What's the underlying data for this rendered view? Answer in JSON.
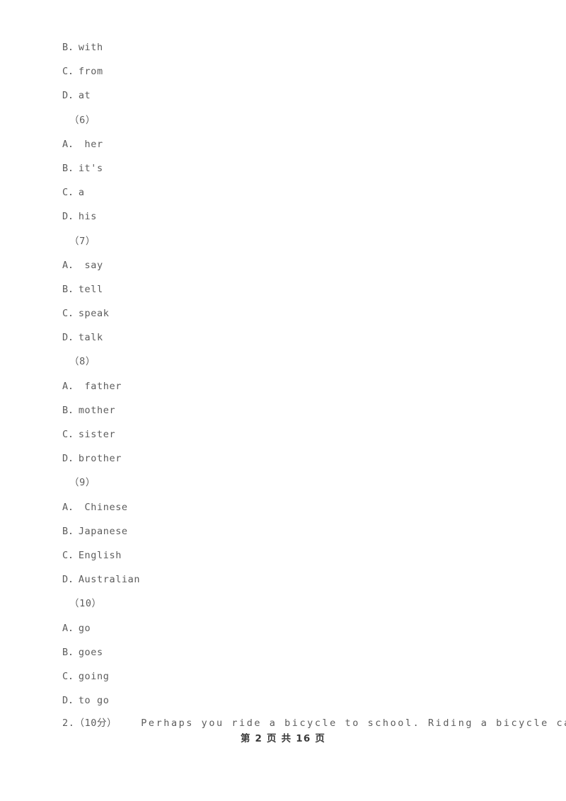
{
  "document": {
    "page_footer": "第 2 页 共 16 页",
    "lines": [
      {
        "kind": "option",
        "text": "B．with"
      },
      {
        "kind": "option",
        "text": "C．from"
      },
      {
        "kind": "option",
        "text": "D．at"
      },
      {
        "kind": "question",
        "text": "（6）"
      },
      {
        "kind": "option",
        "text": "A． her"
      },
      {
        "kind": "option",
        "text": "B．it's"
      },
      {
        "kind": "option",
        "text": "C．a"
      },
      {
        "kind": "option",
        "text": "D．his"
      },
      {
        "kind": "question",
        "text": "（7）"
      },
      {
        "kind": "option",
        "text": "A． say"
      },
      {
        "kind": "option",
        "text": "B．tell"
      },
      {
        "kind": "option",
        "text": "C．speak"
      },
      {
        "kind": "option",
        "text": "D．talk"
      },
      {
        "kind": "question",
        "text": "（8）"
      },
      {
        "kind": "option",
        "text": "A． father"
      },
      {
        "kind": "option",
        "text": "B．mother"
      },
      {
        "kind": "option",
        "text": "C．sister"
      },
      {
        "kind": "option",
        "text": "D．brother"
      },
      {
        "kind": "question",
        "text": "（9）"
      },
      {
        "kind": "option",
        "text": "A． Chinese"
      },
      {
        "kind": "option",
        "text": "B．Japanese"
      },
      {
        "kind": "option",
        "text": "C．English"
      },
      {
        "kind": "option",
        "text": "D．Australian"
      },
      {
        "kind": "question",
        "text": "（10）"
      },
      {
        "kind": "option",
        "text": "A．go"
      },
      {
        "kind": "option",
        "text": "B．goes"
      },
      {
        "kind": "option",
        "text": "C．going"
      },
      {
        "kind": "option",
        "text": "D．to go"
      }
    ],
    "paragraph": {
      "number": "2.",
      "marks": "（10分）",
      "text": "Perhaps you ride a bicycle to school. Riding a bicycle can be great fun. Do"
    }
  }
}
